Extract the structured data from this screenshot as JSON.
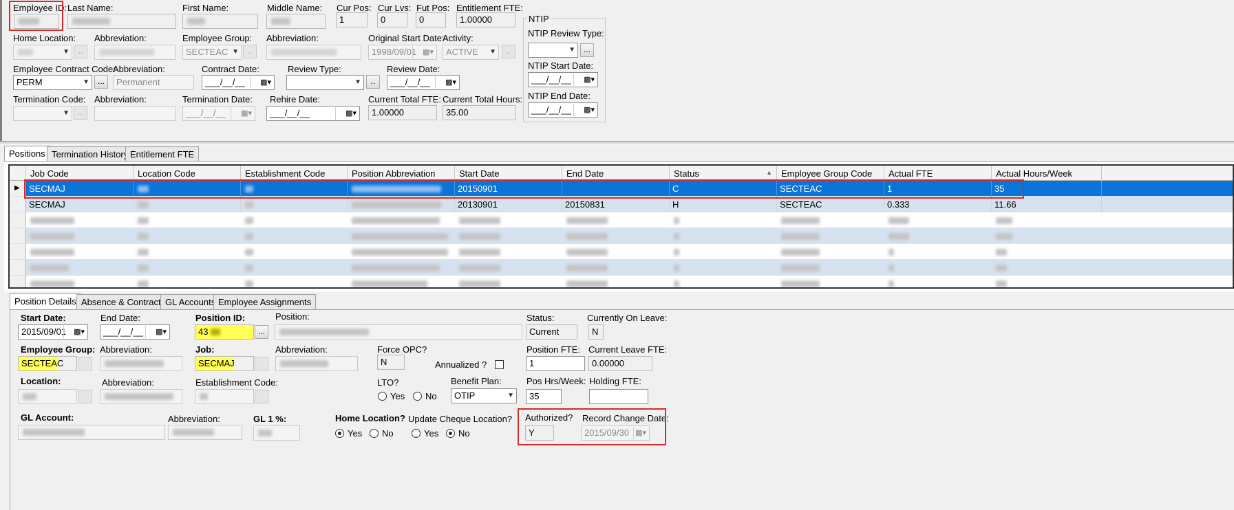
{
  "header": {
    "employee_id_label": "Employee ID:",
    "last_name_label": "Last Name:",
    "first_name_label": "First Name:",
    "middle_name_label": "Middle Name:",
    "cur_pos_label": "Cur Pos:",
    "cur_pos_value": "1",
    "cur_lvs_label": "Cur Lvs:",
    "cur_lvs_value": "0",
    "fut_pos_label": "Fut Pos:",
    "fut_pos_value": "0",
    "entitlement_fte_label": "Entitlement FTE:",
    "entitlement_fte_value": "1.00000",
    "home_location_label": "Home Location:",
    "abbreviation_label": "Abbreviation:",
    "employee_group_label": "Employee Group:",
    "employee_group_value": "SECTEAC",
    "original_start_label": "Original Start Date:",
    "original_start_value": "1998/09/01",
    "activity_label": "Activity:",
    "activity_value": "ACTIVE",
    "contract_code_label": "Employee Contract Code:",
    "contract_code_value": "PERM",
    "contract_abbrev_value": "Permanent",
    "contract_date_label": "Contract Date:",
    "review_type_label": "Review Type:",
    "review_date_label": "Review Date:",
    "termination_code_label": "Termination Code:",
    "termination_date_label": "Termination Date:",
    "rehire_date_label": "Rehire Date:",
    "current_total_fte_label": "Current Total FTE:",
    "current_total_fte_value": "1.00000",
    "current_total_hours_label": "Current Total Hours:",
    "current_total_hours_value": "35.00",
    "empty_date": "___/__/__",
    "ntip": {
      "title": "NTIP",
      "review_type_label": "NTIP Review Type:",
      "start_date_label": "NTIP Start Date:",
      "end_date_label": "NTIP End Date:"
    }
  },
  "top_tabs": [
    "Positions",
    "Termination History",
    "Entitlement FTE"
  ],
  "grid": {
    "columns": [
      "Job Code",
      "Location Code",
      "Establishment Code",
      "Position Abbreviation",
      "Start Date",
      "End Date",
      "Status",
      "Employee Group Code",
      "Actual FTE",
      "Actual Hours/Week"
    ],
    "rows": [
      {
        "job_code": "SECMAJ",
        "start_date": "20150901",
        "end_date": "",
        "status": "C",
        "group": "SECTEAC",
        "fte": "1",
        "hours": "35"
      },
      {
        "job_code": "SECMAJ",
        "start_date": "20130901",
        "end_date": "20150831",
        "status": "H",
        "group": "SECTEAC",
        "fte": "0.333",
        "hours": "11.66"
      }
    ]
  },
  "bottom_tabs": [
    "Position Details",
    "Absence & Contracts",
    "GL Accounts",
    "Employee Assignments"
  ],
  "details": {
    "start_date_label": "Start Date:",
    "start_date_value": "2015/09/01",
    "end_date_label": "End Date:",
    "position_id_label": "Position ID:",
    "position_id_value": "43",
    "position_label": "Position:",
    "status_label": "Status:",
    "status_value": "Current",
    "on_leave_label": "Currently On Leave:",
    "on_leave_value": "N",
    "employee_group_label": "Employee Group:",
    "employee_group_value": "SECTEAC",
    "abbreviation_label": "Abbreviation:",
    "job_label": "Job:",
    "job_value": "SECMAJ",
    "force_opc_label": "Force OPC?",
    "force_opc_value": "N",
    "annualized_label": "Annualized ?",
    "position_fte_label": "Position FTE:",
    "position_fte_value": "1",
    "current_leave_fte_label": "Current Leave FTE:",
    "current_leave_fte_value": "0.00000",
    "location_label": "Location:",
    "establishment_label": "Establishment Code:",
    "lto_label": "LTO?",
    "yes": "Yes",
    "no": "No",
    "benefit_plan_label": "Benefit Plan:",
    "benefit_plan_value": "OTIP",
    "pos_hrs_label": "Pos Hrs/Week:",
    "pos_hrs_value": "35",
    "holding_fte_label": "Holding FTE:",
    "gl_account_label": "GL Account:",
    "gl_pct_label": "GL 1 %:",
    "home_location_label": "Home Location?",
    "update_cheque_label": "Update Cheque Location?",
    "authorized_label": "Authorized?",
    "authorized_value": "Y",
    "record_change_label": "Record Change Date:",
    "record_change_value": "2015/09/30"
  }
}
